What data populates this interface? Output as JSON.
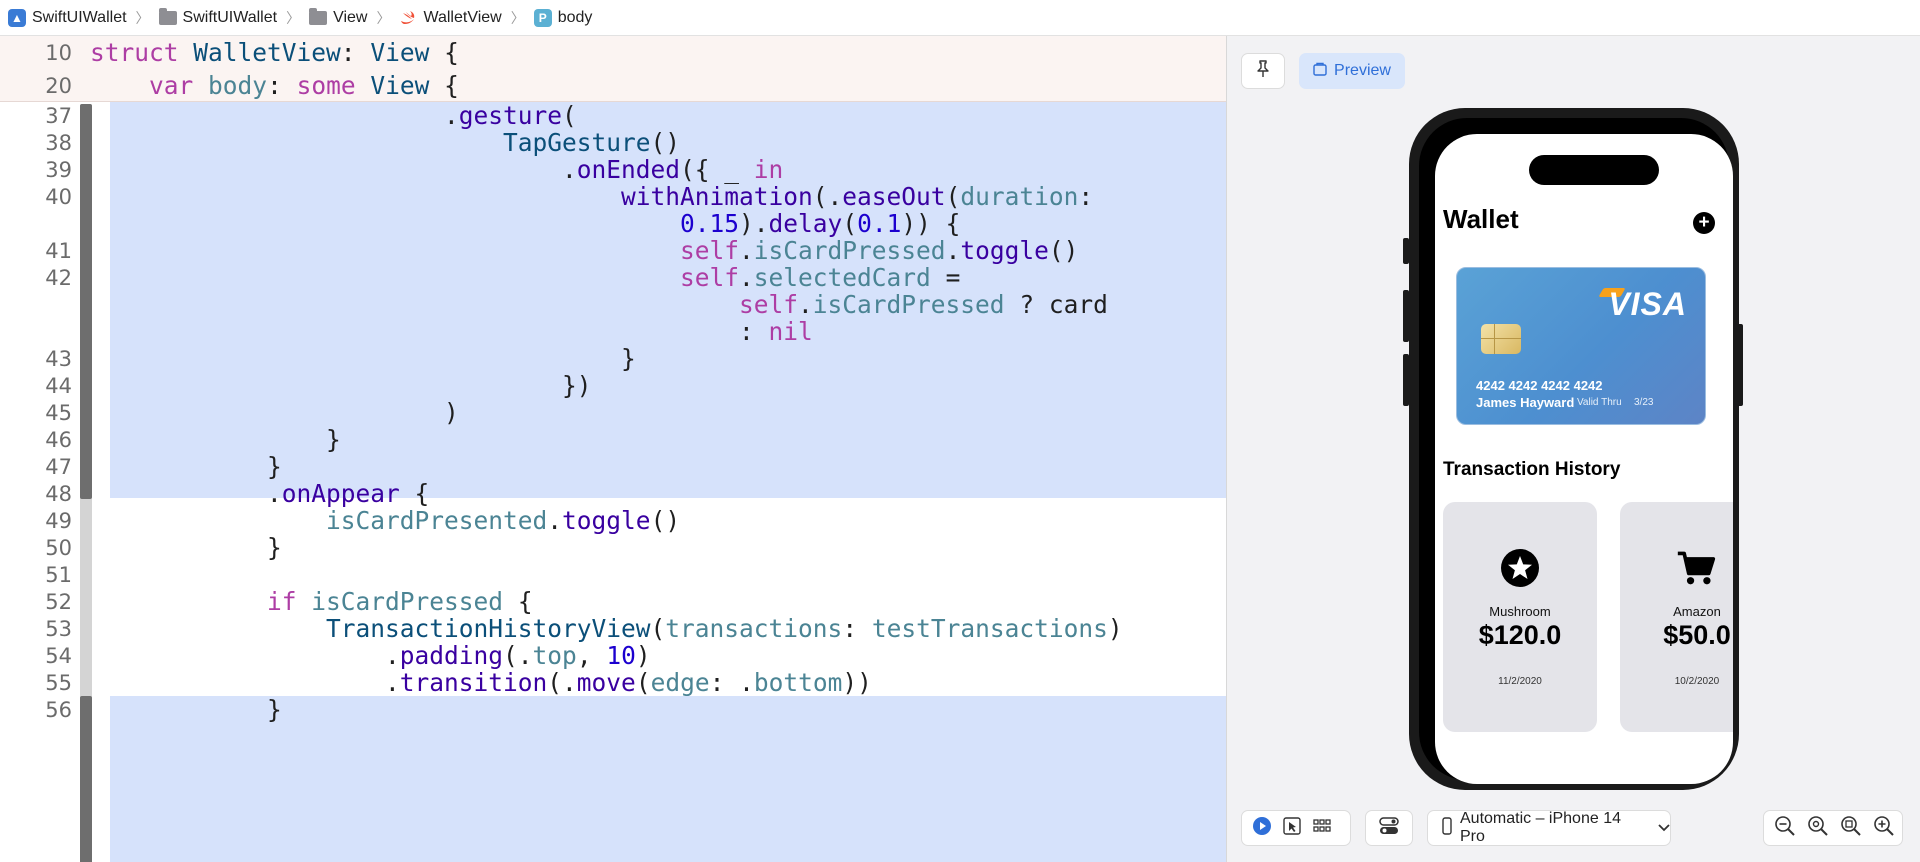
{
  "breadcrumb": [
    {
      "label": "SwiftUIWallet",
      "icon": "xcode-app-icon"
    },
    {
      "label": "SwiftUIWallet",
      "icon": "folder-icon"
    },
    {
      "label": "View",
      "icon": "folder-icon"
    },
    {
      "label": "WalletView",
      "icon": "swift-file-icon"
    },
    {
      "label": "body",
      "icon": "property-icon",
      "badge": "P"
    }
  ],
  "sticky_lines": [
    {
      "num": "10",
      "code": "struct WalletView: View {"
    },
    {
      "num": "20",
      "code": "    var body: some View {"
    }
  ],
  "code_lines": [
    {
      "num": "37",
      "code": "                        .gesture("
    },
    {
      "num": "38",
      "code": "                            TapGesture()"
    },
    {
      "num": "39",
      "code": "                                .onEnded({ _ in"
    },
    {
      "num": "40",
      "code": "                                    withAnimation(.easeOut(duration:"
    },
    {
      "num": "",
      "code": "                                        0.15).delay(0.1)) {"
    },
    {
      "num": "41",
      "code": "                                        self.isCardPressed.toggle()"
    },
    {
      "num": "42",
      "code": "                                        self.selectedCard ="
    },
    {
      "num": "",
      "code": "                                            self.isCardPressed ? card"
    },
    {
      "num": "",
      "code": "                                            : nil"
    },
    {
      "num": "43",
      "code": "                                    }"
    },
    {
      "num": "44",
      "code": "                                })"
    },
    {
      "num": "45",
      "code": "                        )"
    },
    {
      "num": "46",
      "code": "                }"
    },
    {
      "num": "47",
      "code": "            }"
    },
    {
      "num": "48",
      "code": "            .onAppear {"
    },
    {
      "num": "49",
      "code": "                isCardPresented.toggle()"
    },
    {
      "num": "50",
      "code": "            }"
    },
    {
      "num": "51",
      "code": ""
    },
    {
      "num": "52",
      "code": "            if isCardPressed {"
    },
    {
      "num": "53",
      "code": "                TransactionHistoryView(transactions: testTransactions)"
    },
    {
      "num": "54",
      "code": "                    .padding(.top, 10)"
    },
    {
      "num": "55",
      "code": "                    .transition(.move(edge: .bottom))"
    },
    {
      "num": "56",
      "code": "            }"
    }
  ],
  "preview": {
    "button_label": "Preview",
    "device_label": "Automatic – iPhone 14 Pro",
    "app": {
      "title": "Wallet",
      "card": {
        "brand": "VISA",
        "number": "4242 4242 4242 4242",
        "holder": "James Hayward",
        "valid_label": "Valid Thru",
        "valid_date": "3/23"
      },
      "history_title": "Transaction History",
      "transactions": [
        {
          "merchant": "Mushroom",
          "amount": "$120.0",
          "date": "11/2/2020",
          "icon": "star-circle-icon"
        },
        {
          "merchant": "Amazon",
          "amount": "$50.0",
          "date": "10/2/2020",
          "icon": "cart-icon"
        }
      ]
    }
  },
  "colors": {
    "highlight": "#d6e2fb",
    "keyword": "#ad3da4",
    "type": "#0b4f79",
    "member": "#4b8494",
    "number": "#1c00cf",
    "accent": "#2f6fd8"
  }
}
